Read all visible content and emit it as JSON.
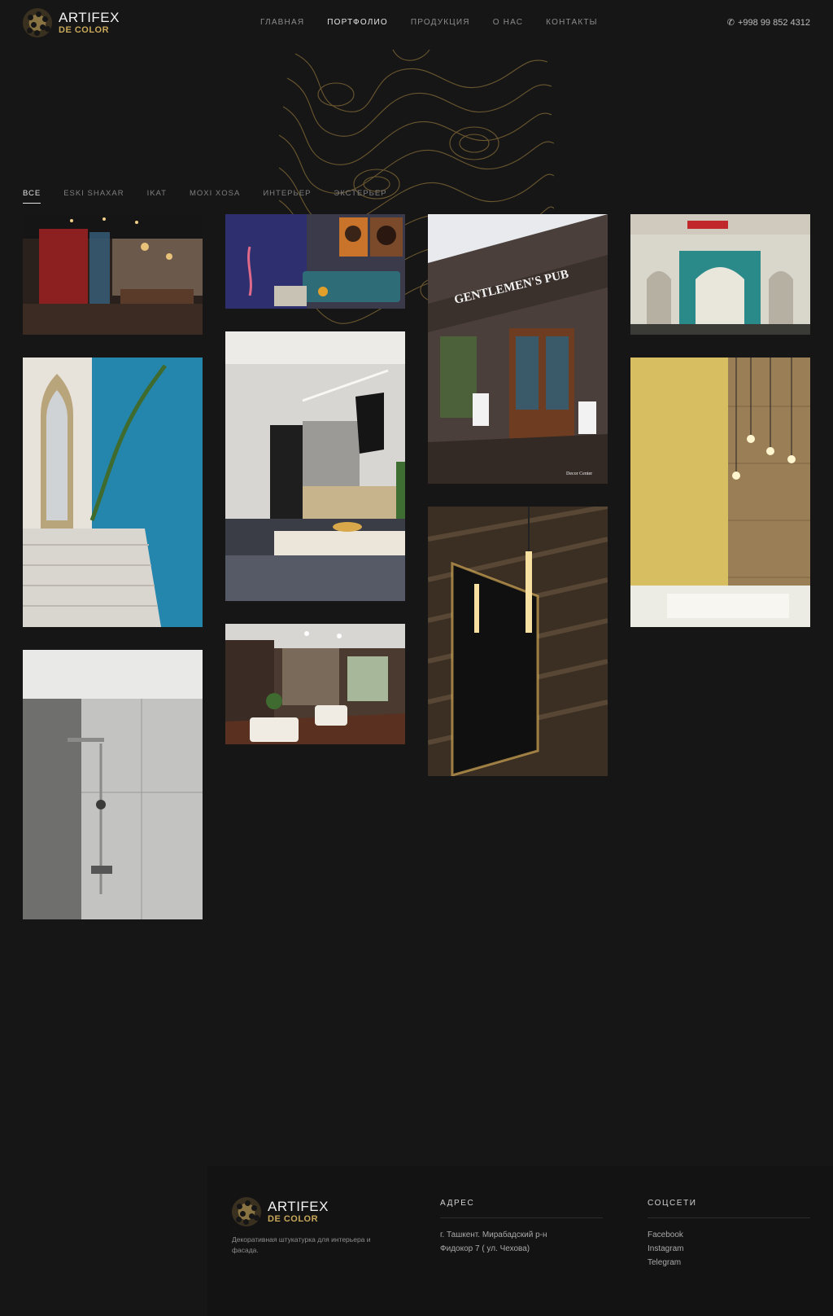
{
  "brand": {
    "name": "ARTIFEX",
    "sub": "DE COLOR",
    "gold": "#c8a85a"
  },
  "nav": {
    "items": [
      "ГЛАВНАЯ",
      "ПОРТФОЛИО",
      "ПРОДУКЦИЯ",
      "О НАС",
      "КОНТАКТЫ"
    ],
    "active": "ПОРТФОЛИО"
  },
  "phone": {
    "icon": "phone-icon",
    "number": "+998 99 852 4312"
  },
  "filters": {
    "items": [
      "ВСЕ",
      "ESKI SHAXAR",
      "IKAT",
      "MOXI XOSA",
      "ИНТЕРЬЕР",
      "ЭКСТЕРЬЕР"
    ],
    "active": "ВСЕ"
  },
  "gallery": [
    {
      "name": "restaurant-interior-photo",
      "caption": ""
    },
    {
      "name": "lounge-with-art-photo",
      "caption": ""
    },
    {
      "name": "gentlemens-pub-photo",
      "sign": "GENTLEMEN'S PUB",
      "watermark": "Decor Center"
    },
    {
      "name": "oriental-facade-photo"
    },
    {
      "name": "blue-staircase-photo"
    },
    {
      "name": "modern-kitchen-photo"
    },
    {
      "name": "bathroom-pendant-lights-photo"
    },
    {
      "name": "mirror-wall-lights-photo"
    },
    {
      "name": "cafe-interior-photo"
    },
    {
      "name": "shower-tiles-photo"
    }
  ],
  "footer": {
    "description": "Декоративная штукатурка для интерьера и фасада.",
    "address_title": "АДРЕС",
    "address_line1": "г. Ташкент. Мирабадский р-н",
    "address_line2": "Фидокор 7 ( ул. Чехова)",
    "social_title": "СОЦСЕТИ",
    "social": [
      "Facebook",
      "Instagram",
      "Telegram"
    ]
  }
}
